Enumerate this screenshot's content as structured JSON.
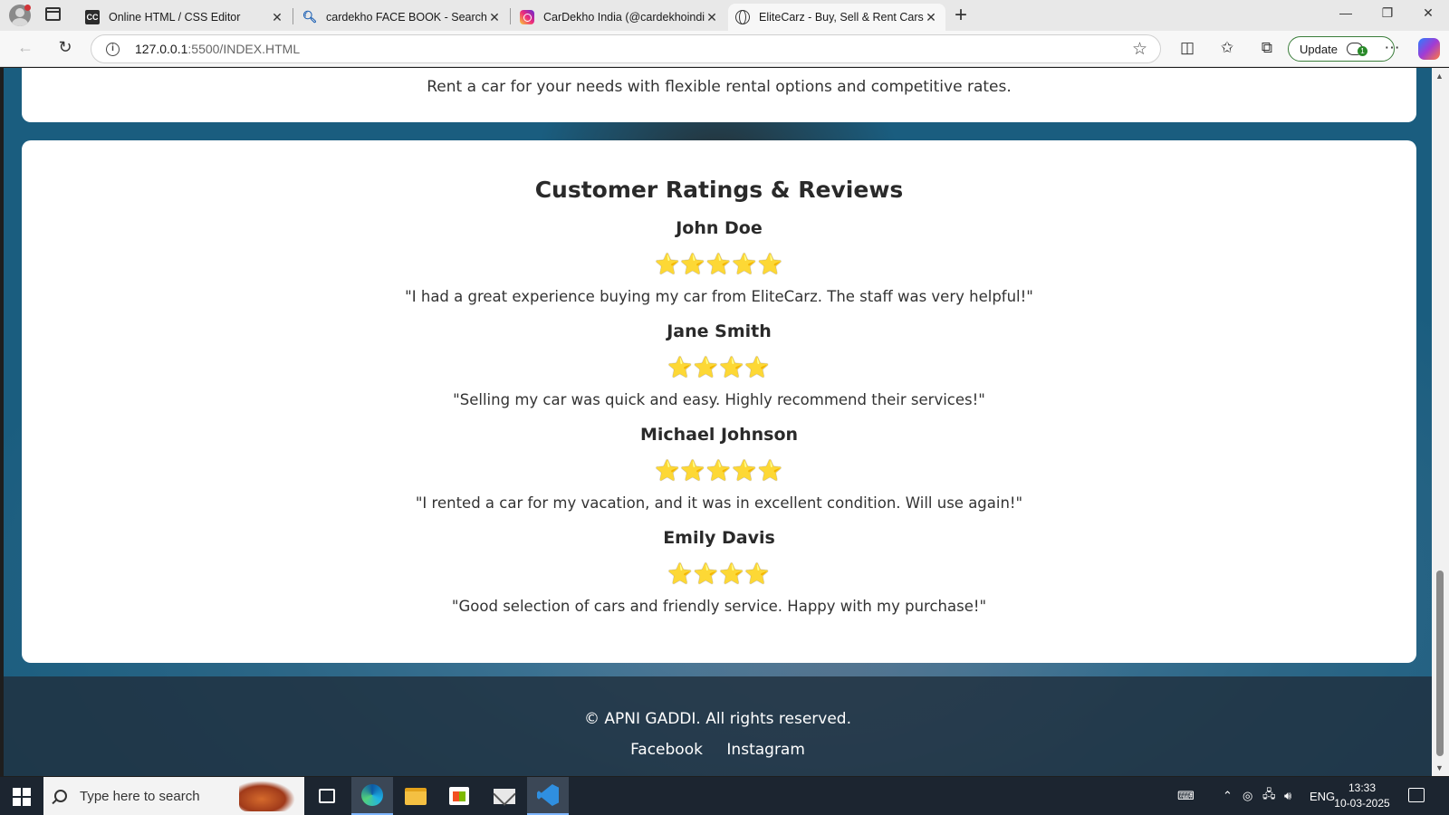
{
  "browser": {
    "tabs": [
      {
        "favicon": "cc-icon",
        "title": "Online HTML / CSS Editor",
        "active": false
      },
      {
        "favicon": "search-icon",
        "title": "cardekho FACE BOOK - Search",
        "active": false
      },
      {
        "favicon": "instagram-icon",
        "title": "CarDekho India (@cardekhoindia)",
        "active": false
      },
      {
        "favicon": "globe-icon",
        "title": "EliteCarz - Buy, Sell & Rent Cars",
        "active": true
      }
    ],
    "address": {
      "host": "127.0.0.1",
      "path": ":5500/INDEX.HTML"
    },
    "update_label": "Update"
  },
  "page": {
    "rent_text": "Rent a car for your needs with flexible rental options and competitive rates.",
    "reviews": {
      "heading": "Customer Ratings & Reviews",
      "items": [
        {
          "name": "John Doe",
          "rating": 5,
          "stars": "⭐⭐⭐⭐⭐",
          "text": "\"I had a great experience buying my car from EliteCarz. The staff was very helpful!\""
        },
        {
          "name": "Jane Smith",
          "rating": 4,
          "stars": "⭐⭐⭐⭐",
          "text": "\"Selling my car was quick and easy. Highly recommend their services!\""
        },
        {
          "name": "Michael Johnson",
          "rating": 5,
          "stars": "⭐⭐⭐⭐⭐",
          "text": "\"I rented a car for my vacation, and it was in excellent condition. Will use again!\""
        },
        {
          "name": "Emily Davis",
          "rating": 4,
          "stars": "⭐⭐⭐⭐",
          "text": "\"Good selection of cars and friendly service. Happy with my purchase!\""
        }
      ]
    },
    "footer": {
      "copyright": "© APNI GADDI. All rights reserved.",
      "links": [
        "Facebook",
        "Instagram"
      ]
    }
  },
  "taskbar": {
    "search_placeholder": "Type here to search",
    "language": "ENG",
    "time": "13:33",
    "date": "10-03-2025"
  }
}
